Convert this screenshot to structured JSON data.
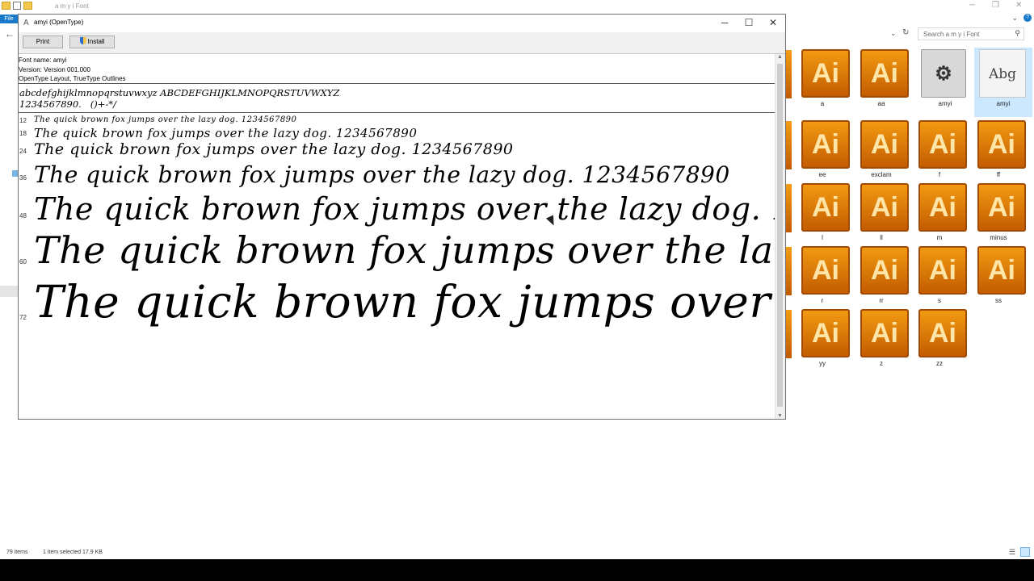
{
  "explorer": {
    "title": "a m y i  Font",
    "file_tab": "File",
    "search_placeholder": "Search a m y i  Font",
    "status_count": "79 items",
    "status_selection": "1 item selected  17.9 KB",
    "items": [
      {
        "label": "a",
        "icon": "illustrator-file-icon"
      },
      {
        "label": "aa",
        "icon": "illustrator-file-icon"
      },
      {
        "label": "amyi",
        "icon": "font-compressed-icon"
      },
      {
        "label": "amyi",
        "icon": "font-file-icon",
        "preview": "Abg"
      },
      {
        "label": "ee",
        "icon": "illustrator-file-icon"
      },
      {
        "label": "exclam",
        "icon": "illustrator-file-icon"
      },
      {
        "label": "f",
        "icon": "illustrator-file-icon"
      },
      {
        "label": "ff",
        "icon": "illustrator-file-icon"
      },
      {
        "label": "l",
        "icon": "illustrator-file-icon"
      },
      {
        "label": "ll",
        "icon": "illustrator-file-icon"
      },
      {
        "label": "m",
        "icon": "illustrator-file-icon"
      },
      {
        "label": "minus",
        "icon": "illustrator-file-icon"
      },
      {
        "label": "r",
        "icon": "illustrator-file-icon"
      },
      {
        "label": "rr",
        "icon": "illustrator-file-icon"
      },
      {
        "label": "s",
        "icon": "illustrator-file-icon"
      },
      {
        "label": "ss",
        "icon": "illustrator-file-icon"
      },
      {
        "label": "yy",
        "icon": "illustrator-file-icon"
      },
      {
        "label": "z",
        "icon": "illustrator-file-icon"
      },
      {
        "label": "zz",
        "icon": "illustrator-file-icon"
      }
    ],
    "ai_text": "Ai"
  },
  "viewer": {
    "title": "amyi (OpenType)",
    "print_label": "Print",
    "install_label": "Install",
    "font_name": "Font name: amyi",
    "version": "Version: Version 001.000",
    "outline": "OpenType Layout, TrueType Outlines",
    "charset_line1": "abcdefghijklmnopqrstuvwxyz ABCDEFGHIJKLMNOPQRSTUVWXYZ",
    "charset_line2": "1234567890.   ()+-*/",
    "samples": [
      {
        "size": "12",
        "text": "The quick brown fox jumps over the lazy dog. 1234567890"
      },
      {
        "size": "18",
        "text": "The quick brown fox jumps over the lazy dog. 1234567890"
      },
      {
        "size": "24",
        "text": "The quick brown fox jumps over the lazy dog. 1234567890"
      },
      {
        "size": "36",
        "text": "The quick brown fox jumps over the lazy dog. 1234567890"
      },
      {
        "size": "48",
        "text": "The quick brown fox jumps over the lazy dog. 1"
      },
      {
        "size": "60",
        "text": "The quick brown fox jumps over the la"
      },
      {
        "size": "72",
        "text": "The quick brown fox jumps over"
      }
    ]
  }
}
